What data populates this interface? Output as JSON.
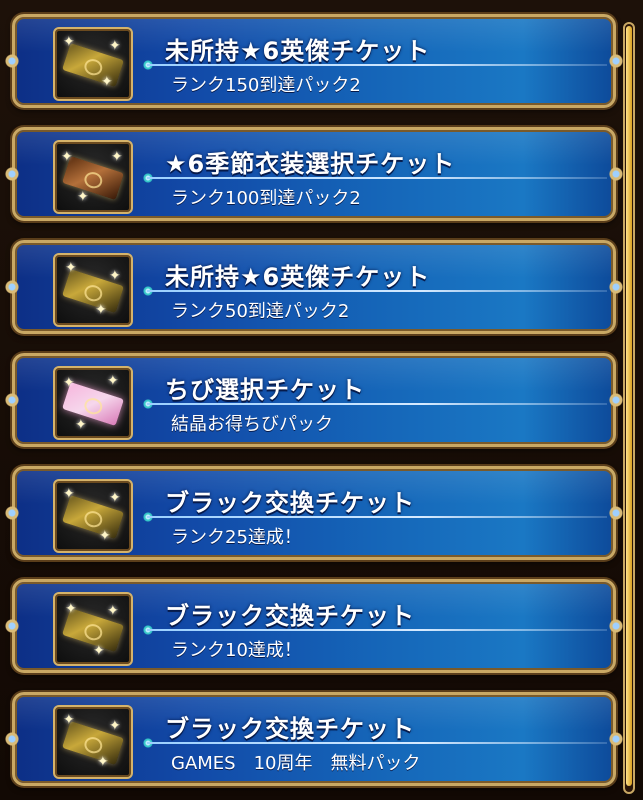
{
  "items": [
    {
      "title": "未所持★6英傑チケット",
      "subtitle": "ランク150到達パック2",
      "icon": "gold-ticket-icon",
      "variant": "gold"
    },
    {
      "title": "★6季節衣装選択チケット",
      "subtitle": "ランク100到達パック2",
      "icon": "bronze-ticket-icon",
      "variant": "bronze"
    },
    {
      "title": "未所持★6英傑チケット",
      "subtitle": "ランク50到達パック2",
      "icon": "gold-ticket-icon",
      "variant": "gold"
    },
    {
      "title": "ちび選択チケット",
      "subtitle": "結晶お得ちびパック",
      "icon": "pink-ticket-icon",
      "variant": "pink"
    },
    {
      "title": "ブラック交換チケット",
      "subtitle": "ランク25達成！",
      "icon": "black-ticket-icon",
      "variant": "gold"
    },
    {
      "title": "ブラック交換チケット",
      "subtitle": "ランク10達成！",
      "icon": "black-ticket-icon",
      "variant": "gold"
    },
    {
      "title": "ブラック交換チケット",
      "subtitle": "GAMES　10周年　無料パック",
      "icon": "black-ticket-icon",
      "variant": "gold"
    }
  ],
  "colors": {
    "frame": "#c9a864",
    "panel": "#1565b8",
    "text": "#ffffff"
  }
}
